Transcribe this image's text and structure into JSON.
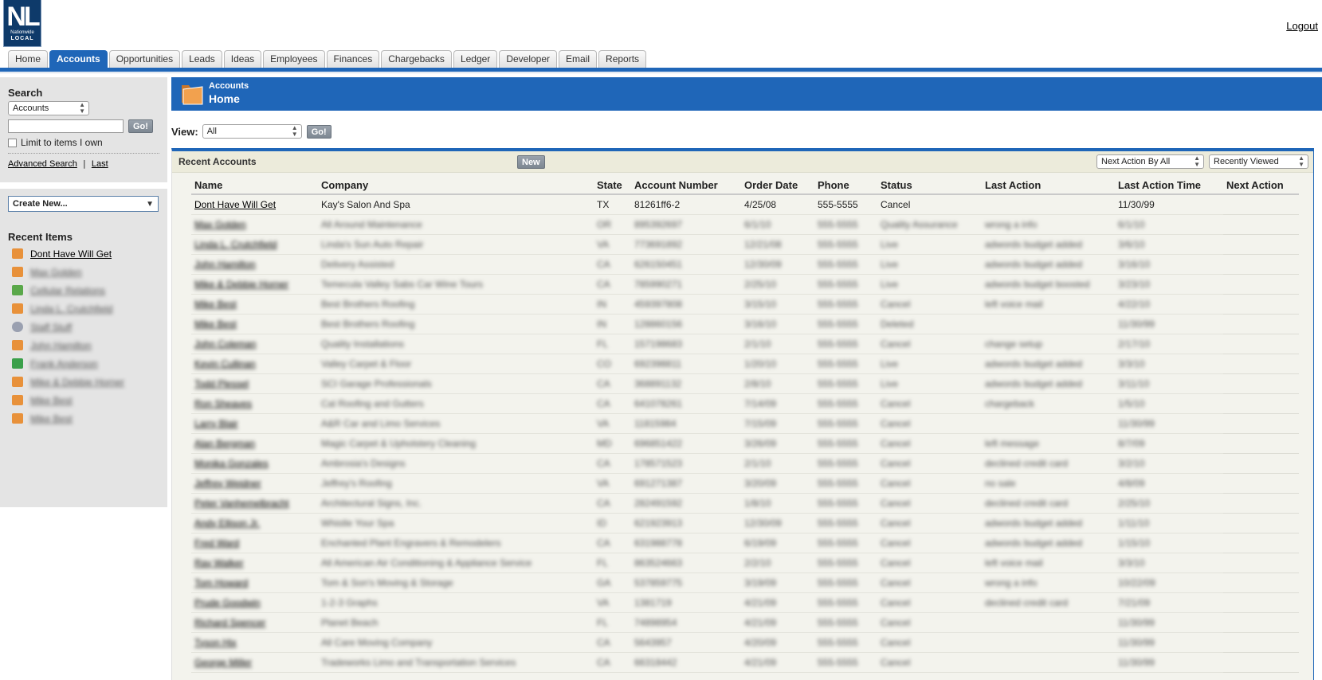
{
  "logo": {
    "line1": "NL",
    "line2": "Nationwide",
    "line3": "LOCAL"
  },
  "header": {
    "logout": "Logout"
  },
  "tabs": [
    "Home",
    "Accounts",
    "Opportunities",
    "Leads",
    "Ideas",
    "Employees",
    "Finances",
    "Chargebacks",
    "Ledger",
    "Developer",
    "Email",
    "Reports"
  ],
  "active_tab": "Accounts",
  "sidebar": {
    "search_heading": "Search",
    "search_scope": "Accounts",
    "search_value": "",
    "go_label": "Go!",
    "limit_label": "Limit to items I own",
    "advanced_search": "Advanced Search",
    "separator": "|",
    "last": "Last",
    "create_new": "Create New...",
    "recent_heading": "Recent Items",
    "recent_items": [
      {
        "label": "Dont Have Will Get",
        "icon": "folder-icon",
        "color": "#e8913a"
      },
      {
        "label": "Max Golden",
        "icon": "folder-icon",
        "color": "#e8913a"
      },
      {
        "label": "Cellular Relations",
        "icon": "contacts-icon",
        "color": "#5aa84a"
      },
      {
        "label": "Linda L. Crutchfield",
        "icon": "folder-icon",
        "color": "#e8913a"
      },
      {
        "label": "Staff Stuff",
        "icon": "idea-icon",
        "color": "#9aa0b0"
      },
      {
        "label": "John Hamilton",
        "icon": "folder-icon",
        "color": "#e8913a"
      },
      {
        "label": "Frank Anderson",
        "icon": "runner-icon",
        "color": "#3aa04a"
      },
      {
        "label": "Mike & Debbie Horner",
        "icon": "folder-icon",
        "color": "#e8913a"
      },
      {
        "label": "Mike Best",
        "icon": "folder-icon",
        "color": "#e8913a"
      },
      {
        "label": "Mike Best",
        "icon": "folder-icon",
        "color": "#e8913a"
      }
    ]
  },
  "page_header": {
    "section": "Accounts",
    "title": "Home"
  },
  "view": {
    "label": "View:",
    "value": "All",
    "go_label": "Go!"
  },
  "panel": {
    "title": "Recent Accounts",
    "new_label": "New",
    "filter_action": "Next Action By All",
    "filter_recent": "Recently Viewed",
    "columns": [
      "Name",
      "Company",
      "State",
      "Account Number",
      "Order Date",
      "Phone",
      "Status",
      "Last Action",
      "Last Action Time",
      "Next Action"
    ],
    "rows": [
      [
        "Dont Have Will Get",
        "Kay's Salon And Spa",
        "TX",
        "81261ff6-2",
        "4/25/08",
        "555-5555",
        "Cancel",
        "",
        "11/30/99",
        ""
      ],
      [
        "Max Golden",
        "All Around Maintenance",
        "OR",
        "895392697",
        "6/1/10",
        "555-5555",
        "Quality Assurance",
        "wrong a info",
        "6/1/10",
        ""
      ],
      [
        "Linda L. Crutchfield",
        "Linda's Sun Auto Repair",
        "VA",
        "773691892",
        "12/21/08",
        "555-5555",
        "Live",
        "adwords budget added",
        "3/6/10",
        ""
      ],
      [
        "John Hamilton",
        "Delivery Assisted",
        "CA",
        "626150451",
        "12/30/09",
        "555-5555",
        "Live",
        "adwords budget added",
        "3/16/10",
        ""
      ],
      [
        "Mike & Debbie Horner",
        "Temecula Valley Sabs Car Wine Tours",
        "CA",
        "785990271",
        "2/25/10",
        "555-5555",
        "Live",
        "adwords budget boosted",
        "3/23/10",
        ""
      ],
      [
        "Mike Best",
        "Best Brothers Roofing",
        "IN",
        "459397808",
        "3/15/10",
        "555-5555",
        "Cancel",
        "left voice mail",
        "4/22/10",
        ""
      ],
      [
        "Mike Best",
        "Best Brothers Roofing",
        "IN",
        "128860156",
        "3/16/10",
        "555-5555",
        "Deleted",
        "",
        "11/30/99",
        ""
      ],
      [
        "John Coleman",
        "Quality Installations",
        "FL",
        "157198683",
        "2/1/10",
        "555-5555",
        "Cancel",
        "change setup",
        "2/17/10",
        ""
      ],
      [
        "Kevin Cullinan",
        "Valley Carpet & Floor",
        "CO",
        "692398811",
        "1/20/10",
        "555-5555",
        "Live",
        "adwords budget added",
        "3/3/10",
        ""
      ],
      [
        "Todd Plessel",
        "SCI Garage Professionals",
        "CA",
        "368891132",
        "2/8/10",
        "555-5555",
        "Live",
        "adwords budget added",
        "3/11/10",
        ""
      ],
      [
        "Ron Sheaves",
        "Cal Roofing and Gutters",
        "CA",
        "641078261",
        "7/14/09",
        "555-5555",
        "Cancel",
        "chargeback",
        "1/5/10",
        ""
      ],
      [
        "Larry Blair",
        "A&R Car and Limo Services",
        "VA",
        "11815984",
        "7/15/09",
        "555-5555",
        "Cancel",
        "",
        "11/30/99",
        ""
      ],
      [
        "Alan Bergman",
        "Magic Carpet & Upholstery Cleaning",
        "MD",
        "696851422",
        "3/26/09",
        "555-5555",
        "Cancel",
        "left message",
        "8/7/09",
        ""
      ],
      [
        "Monika Gonzales",
        "Ambrosia's Designs",
        "CA",
        "178571523",
        "2/1/10",
        "555-5555",
        "Cancel",
        "declined credit card",
        "3/2/10",
        ""
      ],
      [
        "Jeffrey Weidner",
        "Jeffrey's Roofing",
        "VA",
        "691271387",
        "3/20/09",
        "555-5555",
        "Cancel",
        "no sale",
        "4/8/09",
        ""
      ],
      [
        "Peter Vanhemelbracht",
        "Architectural Signs, Inc.",
        "CA",
        "282491592",
        "1/8/10",
        "555-5555",
        "Cancel",
        "declined credit card",
        "2/25/10",
        ""
      ],
      [
        "Andy Ellison Jr.",
        "Whistle Your Spa",
        "ID",
        "621923913",
        "12/30/09",
        "555-5555",
        "Cancel",
        "adwords budget added",
        "1/11/10",
        ""
      ],
      [
        "Fred Ward",
        "Enchanted Plant Engravers & Remodelers",
        "CA",
        "631988778",
        "6/19/09",
        "555-5555",
        "Cancel",
        "adwords budget added",
        "1/15/10",
        ""
      ],
      [
        "Ray Walker",
        "All American Air Conditioning & Appliance Service",
        "FL",
        "863524663",
        "2/2/10",
        "555-5555",
        "Cancel",
        "left voice mail",
        "3/3/10",
        ""
      ],
      [
        "Tom Howard",
        "Tom & Son's Moving & Storage",
        "GA",
        "537859775",
        "3/19/09",
        "555-5555",
        "Cancel",
        "wrong a info",
        "10/22/09",
        ""
      ],
      [
        "Prude Goodwin",
        "1-2-3 Graphs",
        "VA",
        "1381719",
        "4/21/09",
        "555-5555",
        "Cancel",
        "declined credit card",
        "7/21/09",
        ""
      ],
      [
        "Richard Spencer",
        "Planet Beach",
        "FL",
        "74898954",
        "4/21/09",
        "555-5555",
        "Cancel",
        "",
        "11/30/99",
        ""
      ],
      [
        "Tyson Hix",
        "All Care Moving Company",
        "CA",
        "5643957",
        "4/20/09",
        "555-5555",
        "Cancel",
        "",
        "11/30/99",
        ""
      ],
      [
        "George Miller",
        "Tradeworks Limo and Transportation Services",
        "CA",
        "66318442",
        "4/21/09",
        "555-5555",
        "Cancel",
        "",
        "11/30/99",
        ""
      ]
    ]
  },
  "colors": {
    "brand_blue": "#1f66b8",
    "panel_bg": "#f3f3ed",
    "panel_head": "#ecebdb",
    "folder": "#e8913a"
  }
}
